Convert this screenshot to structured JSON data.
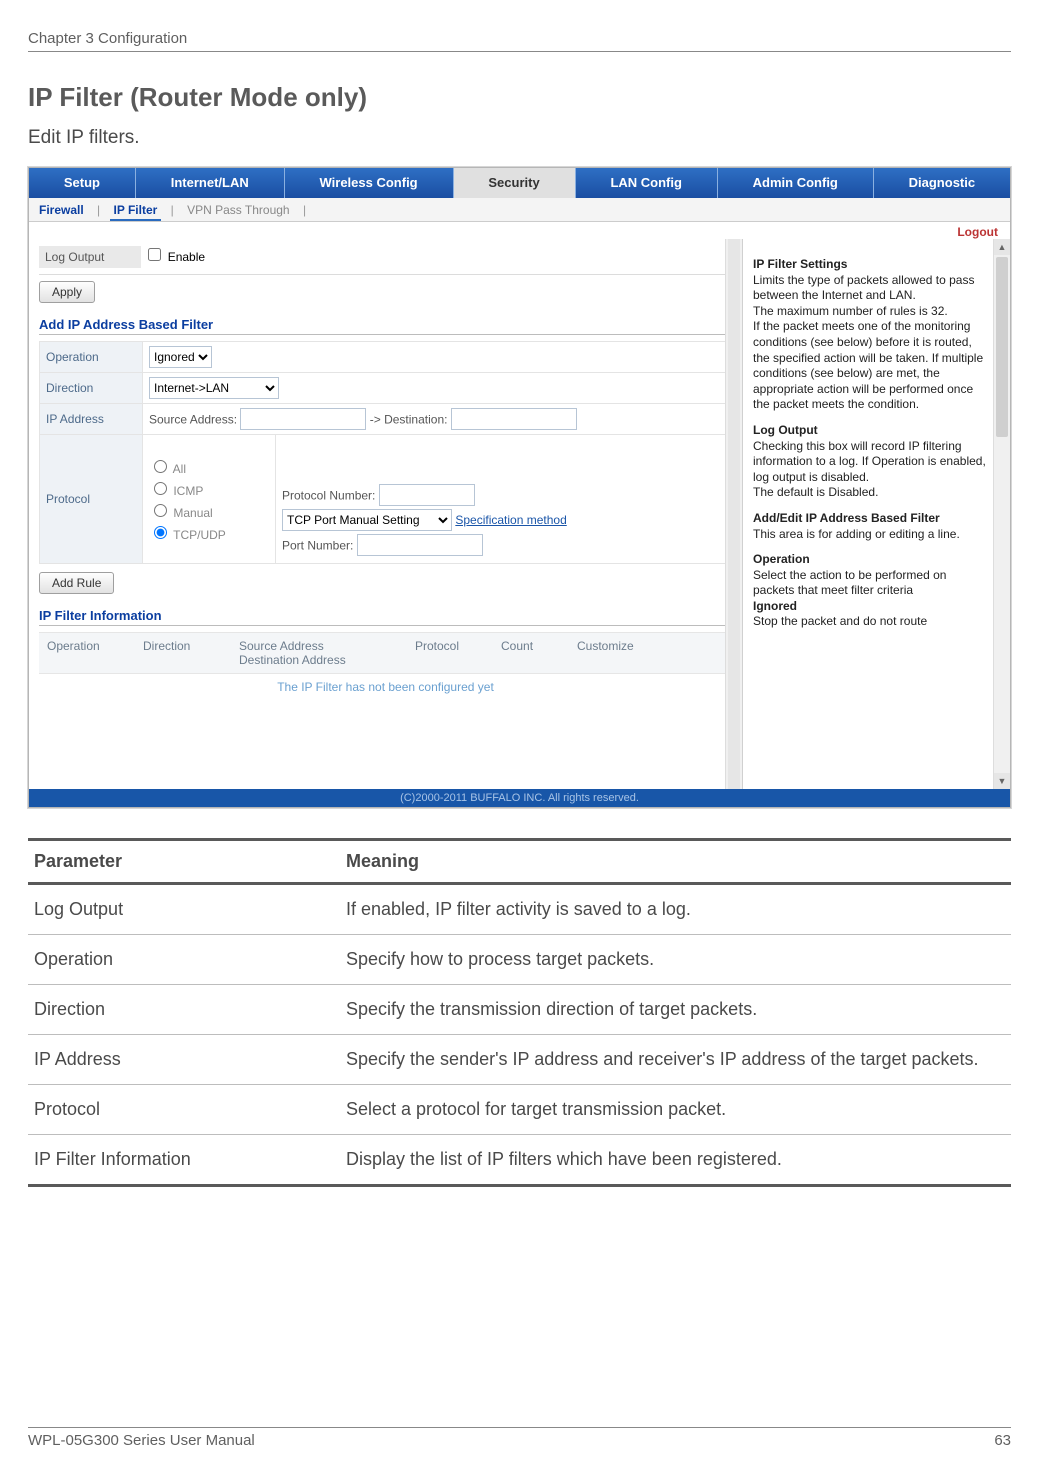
{
  "doc": {
    "chapter_header": "Chapter 3  Configuration",
    "footer_left": "WPL-05G300 Series User Manual",
    "footer_right": "63"
  },
  "page": {
    "title": "IP Filter (Router Mode only)",
    "intro": "Edit IP filters."
  },
  "tabs": {
    "main": [
      "Setup",
      "Internet/LAN",
      "Wireless Config",
      "Security",
      "LAN Config",
      "Admin Config",
      "Diagnostic"
    ],
    "main_active_index": 3,
    "sub": [
      "Firewall",
      "IP Filter",
      "VPN Pass Through"
    ],
    "sub_active_index": 1
  },
  "logout": "Logout",
  "log_section": {
    "label": "Log Output",
    "enable": "Enable",
    "apply": "Apply"
  },
  "add_filter": {
    "heading": "Add IP Address Based Filter",
    "operation_label": "Operation",
    "operation_value": "Ignored",
    "direction_label": "Direction",
    "direction_value": "Internet->LAN",
    "ipaddr_label": "IP Address",
    "source_label": "Source Address:",
    "dest_label": "-> Destination:",
    "protocol_label": "Protocol",
    "proto_all": "All",
    "proto_icmp": "ICMP",
    "proto_manual": "Manual",
    "proto_manual_num": "Protocol Number:",
    "proto_tcpudp": "TCP/UDP",
    "tcp_port_setting": "TCP Port Manual Setting",
    "spec_method": "Specification method",
    "port_number": "Port Number:",
    "add_rule": "Add Rule"
  },
  "info": {
    "heading": "IP Filter Information",
    "cols": [
      "Operation",
      "Direction",
      "Source Address\nDestination Address",
      "Protocol",
      "Count",
      "Customize"
    ],
    "empty": "The IP Filter has not been configured yet"
  },
  "footer_bar": "(C)2000-2011 BUFFALO INC. All rights reserved.",
  "help": {
    "h1": "IP Filter Settings",
    "p1": "Limits the type of packets allowed to pass between the Internet and LAN.",
    "p2": "The maximum number of rules is 32.",
    "p3": "If the packet meets one of the monitoring conditions (see below) before it is routed, the specified action will be taken. If multiple conditions (see below) are met, the appropriate action will be performed once the packet meets the condition.",
    "h2": "Log Output",
    "p4": "Checking this box will record IP filtering information to a log. If Operation is enabled, log output is disabled.",
    "p5": "The default is Disabled.",
    "h3": "Add/Edit IP Address Based Filter",
    "p6": "This area is for adding or editing a line.",
    "h4": "Operation",
    "p7": "Select the action to be performed on packets that meet filter criteria",
    "p8a": "Ignored",
    "p8b": "Stop the packet and do not route"
  },
  "param_table": {
    "headers": [
      "Parameter",
      "Meaning"
    ],
    "rows": [
      {
        "param": "Log Output",
        "meaning": "If enabled, IP filter activity is saved to a log."
      },
      {
        "param": "Operation",
        "meaning": "Specify how to process target packets."
      },
      {
        "param": "Direction",
        "meaning": "Specify the transmission direction of target packets."
      },
      {
        "param": "IP Address",
        "meaning": "Specify the sender's IP address and receiver's IP address of the target packets."
      },
      {
        "param": "Protocol",
        "meaning": "Select a protocol for target transmission packet."
      },
      {
        "param": "IP Filter Information",
        "meaning": "Display the list of IP filters which have been registered."
      }
    ]
  }
}
